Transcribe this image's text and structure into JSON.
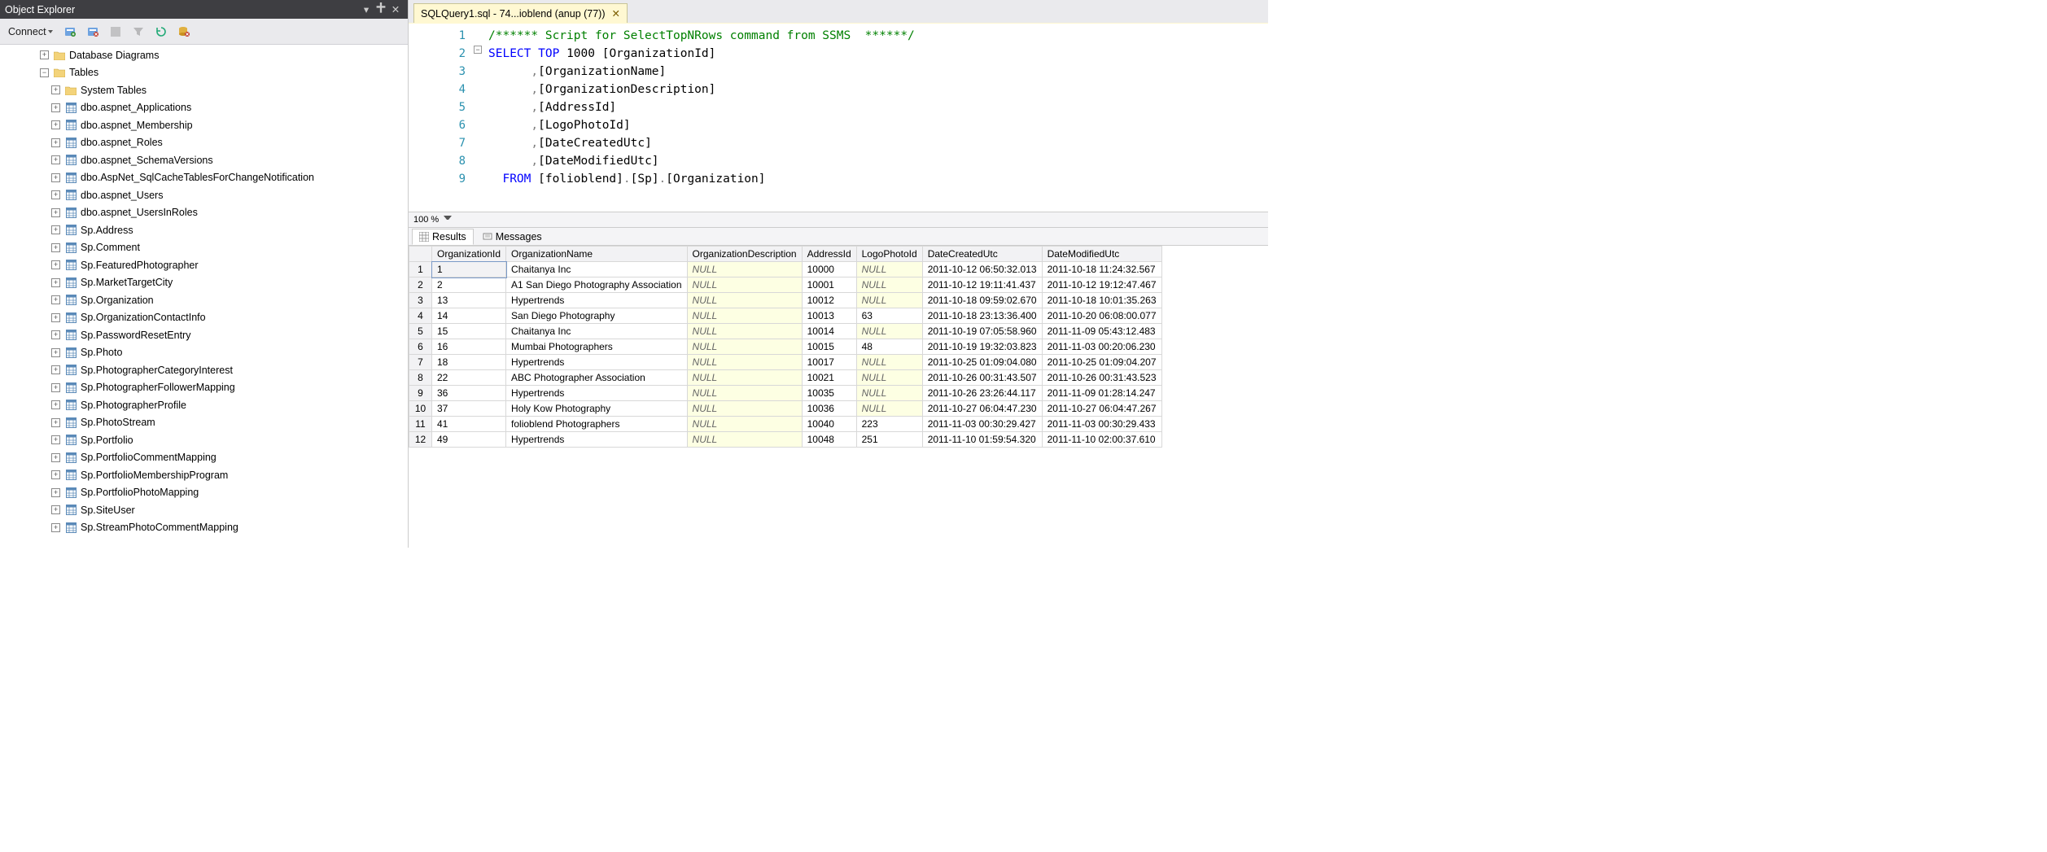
{
  "sidebar": {
    "title": "Object Explorer",
    "connect_label": "Connect",
    "nodes": [
      {
        "indent": 42,
        "exp": "+",
        "icon": "folder",
        "label": "Database Diagrams"
      },
      {
        "indent": 42,
        "exp": "−",
        "icon": "folder",
        "label": "Tables"
      },
      {
        "indent": 56,
        "exp": "+",
        "icon": "folder",
        "label": "System Tables"
      },
      {
        "indent": 56,
        "exp": "+",
        "icon": "table",
        "label": "dbo.aspnet_Applications"
      },
      {
        "indent": 56,
        "exp": "+",
        "icon": "table",
        "label": "dbo.aspnet_Membership"
      },
      {
        "indent": 56,
        "exp": "+",
        "icon": "table",
        "label": "dbo.aspnet_Roles"
      },
      {
        "indent": 56,
        "exp": "+",
        "icon": "table",
        "label": "dbo.aspnet_SchemaVersions"
      },
      {
        "indent": 56,
        "exp": "+",
        "icon": "table",
        "label": "dbo.AspNet_SqlCacheTablesForChangeNotification"
      },
      {
        "indent": 56,
        "exp": "+",
        "icon": "table",
        "label": "dbo.aspnet_Users"
      },
      {
        "indent": 56,
        "exp": "+",
        "icon": "table",
        "label": "dbo.aspnet_UsersInRoles"
      },
      {
        "indent": 56,
        "exp": "+",
        "icon": "table",
        "label": "Sp.Address"
      },
      {
        "indent": 56,
        "exp": "+",
        "icon": "table",
        "label": "Sp.Comment"
      },
      {
        "indent": 56,
        "exp": "+",
        "icon": "table",
        "label": "Sp.FeaturedPhotographer"
      },
      {
        "indent": 56,
        "exp": "+",
        "icon": "table",
        "label": "Sp.MarketTargetCity"
      },
      {
        "indent": 56,
        "exp": "+",
        "icon": "table",
        "label": "Sp.Organization"
      },
      {
        "indent": 56,
        "exp": "+",
        "icon": "table",
        "label": "Sp.OrganizationContactInfo"
      },
      {
        "indent": 56,
        "exp": "+",
        "icon": "table",
        "label": "Sp.PasswordResetEntry"
      },
      {
        "indent": 56,
        "exp": "+",
        "icon": "table",
        "label": "Sp.Photo"
      },
      {
        "indent": 56,
        "exp": "+",
        "icon": "table",
        "label": "Sp.PhotographerCategoryInterest"
      },
      {
        "indent": 56,
        "exp": "+",
        "icon": "table",
        "label": "Sp.PhotographerFollowerMapping"
      },
      {
        "indent": 56,
        "exp": "+",
        "icon": "table",
        "label": "Sp.PhotographerProfile"
      },
      {
        "indent": 56,
        "exp": "+",
        "icon": "table",
        "label": "Sp.PhotoStream"
      },
      {
        "indent": 56,
        "exp": "+",
        "icon": "table",
        "label": "Sp.Portfolio"
      },
      {
        "indent": 56,
        "exp": "+",
        "icon": "table",
        "label": "Sp.PortfolioCommentMapping"
      },
      {
        "indent": 56,
        "exp": "+",
        "icon": "table",
        "label": "Sp.PortfolioMembershipProgram"
      },
      {
        "indent": 56,
        "exp": "+",
        "icon": "table",
        "label": "Sp.PortfolioPhotoMapping"
      },
      {
        "indent": 56,
        "exp": "+",
        "icon": "table",
        "label": "Sp.SiteUser"
      },
      {
        "indent": 56,
        "exp": "+",
        "icon": "table",
        "label": "Sp.StreamPhotoCommentMapping"
      }
    ]
  },
  "tab": {
    "title": "SQLQuery1.sql - 74...ioblend (anup (77))"
  },
  "zoom": {
    "value": "100 %"
  },
  "code_lines": [
    "1",
    "2",
    "3",
    "4",
    "5",
    "6",
    "7",
    "8",
    "9"
  ],
  "code_tokens": {
    "l1": "/****** Script for SelectTopNRows command from SSMS  ******/",
    "l2_select": "SELECT",
    "l2_top": "TOP",
    "l2_num": "1000",
    "l2_col": "[OrganizationId]",
    "l3": ",[OrganizationName]",
    "l4": ",[OrganizationDescription]",
    "l5": ",[AddressId]",
    "l6": ",[LogoPhotoId]",
    "l7": ",[DateCreatedUtc]",
    "l8": ",[DateModifiedUtc]",
    "l9_from": "FROM",
    "l9_db": "[folioblend]",
    "l9_sch": "[Sp]",
    "l9_tbl": "[Organization]"
  },
  "result_tabs": {
    "results": "Results",
    "messages": "Messages"
  },
  "grid": {
    "columns": [
      "",
      "OrganizationId",
      "OrganizationName",
      "OrganizationDescription",
      "AddressId",
      "LogoPhotoId",
      "DateCreatedUtc",
      "DateModifiedUtc"
    ],
    "rows": [
      [
        "1",
        "1",
        "Chaitanya Inc",
        "NULL",
        "10000",
        "NULL",
        "2011-10-12 06:50:32.013",
        "2011-10-18 11:24:32.567"
      ],
      [
        "2",
        "2",
        "A1 San Diego Photography Association",
        "NULL",
        "10001",
        "NULL",
        "2011-10-12 19:11:41.437",
        "2011-10-12 19:12:47.467"
      ],
      [
        "3",
        "13",
        "Hypertrends",
        "NULL",
        "10012",
        "NULL",
        "2011-10-18 09:59:02.670",
        "2011-10-18 10:01:35.263"
      ],
      [
        "4",
        "14",
        "San Diego Photography",
        "NULL",
        "10013",
        "63",
        "2011-10-18 23:13:36.400",
        "2011-10-20 06:08:00.077"
      ],
      [
        "5",
        "15",
        "Chaitanya Inc",
        "NULL",
        "10014",
        "NULL",
        "2011-10-19 07:05:58.960",
        "2011-11-09 05:43:12.483"
      ],
      [
        "6",
        "16",
        "Mumbai Photographers",
        "NULL",
        "10015",
        "48",
        "2011-10-19 19:32:03.823",
        "2011-11-03 00:20:06.230"
      ],
      [
        "7",
        "18",
        "Hypertrends",
        "NULL",
        "10017",
        "NULL",
        "2011-10-25 01:09:04.080",
        "2011-10-25 01:09:04.207"
      ],
      [
        "8",
        "22",
        "ABC Photographer Association",
        "NULL",
        "10021",
        "NULL",
        "2011-10-26 00:31:43.507",
        "2011-10-26 00:31:43.523"
      ],
      [
        "9",
        "36",
        "Hypertrends",
        "NULL",
        "10035",
        "NULL",
        "2011-10-26 23:26:44.117",
        "2011-11-09 01:28:14.247"
      ],
      [
        "10",
        "37",
        "Holy Kow Photography",
        "NULL",
        "10036",
        "NULL",
        "2011-10-27 06:04:47.230",
        "2011-10-27 06:04:47.267"
      ],
      [
        "11",
        "41",
        "folioblend Photographers",
        "NULL",
        "10040",
        "223",
        "2011-11-03 00:30:29.427",
        "2011-11-03 00:30:29.433"
      ],
      [
        "12",
        "49",
        "Hypertrends",
        "NULL",
        "10048",
        "251",
        "2011-11-10 01:59:54.320",
        "2011-11-10 02:00:37.610"
      ]
    ],
    "null_cols": {
      "3": true,
      "5_sometimes": true
    }
  }
}
